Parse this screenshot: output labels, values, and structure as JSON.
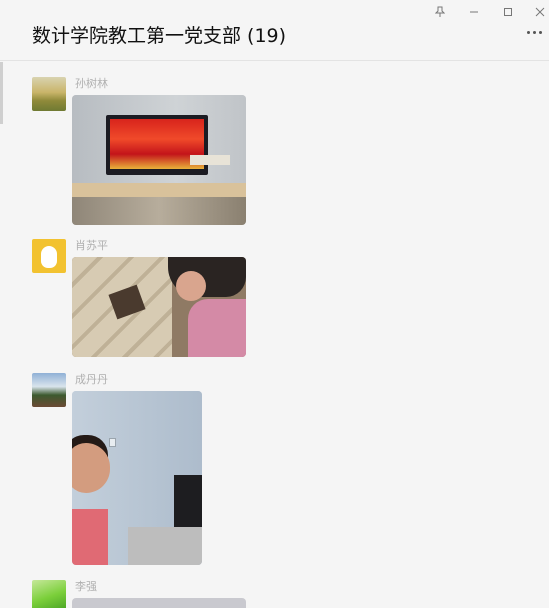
{
  "window": {
    "title": "数计学院教工第一党支部 (19)",
    "controls": {
      "pin": "pin-icon",
      "minimize": "minimize-icon",
      "maximize": "maximize-icon",
      "close": "close-icon",
      "more": "more-icon"
    }
  },
  "messages": [
    {
      "sender": "孙树林",
      "type": "image"
    },
    {
      "sender": "肖苏平",
      "type": "image"
    },
    {
      "sender": "成丹丹",
      "type": "image"
    },
    {
      "sender": "李强",
      "type": "image"
    }
  ],
  "colors": {
    "background": "#f5f5f5",
    "title_text": "#111111",
    "sender_text": "#b0b0b0"
  }
}
